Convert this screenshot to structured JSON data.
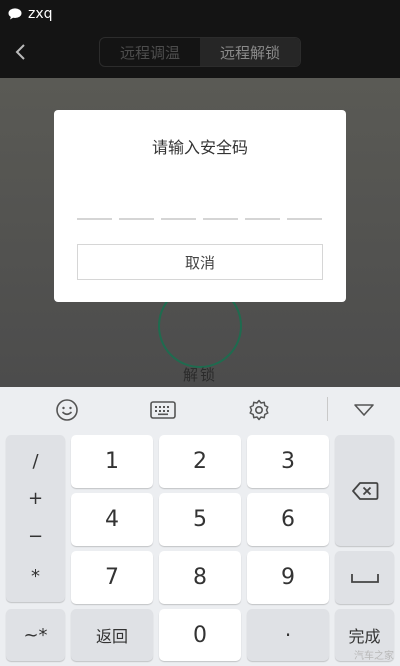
{
  "status_bar": {
    "app_label": "zxq"
  },
  "nav": {
    "tabs": [
      {
        "label": "远程调温",
        "active": false
      },
      {
        "label": "远程解锁",
        "active": true
      }
    ]
  },
  "content": {
    "unlock_label": "解锁"
  },
  "dialog": {
    "title": "请输入安全码",
    "code_length": 6,
    "cancel_label": "取消"
  },
  "keyboard": {
    "toolbar_icons": [
      "emoji-icon",
      "keyboard-icon",
      "settings-icon",
      "collapse-icon"
    ],
    "symbols": [
      "/",
      "+",
      "−",
      "*"
    ],
    "digits": [
      "1",
      "2",
      "3",
      "4",
      "5",
      "6",
      "7",
      "8",
      "9",
      "0"
    ],
    "switch_label": "~*",
    "back_label": "返回",
    "dot_label": "·",
    "done_label": "完成",
    "delete_icon": "backspace-icon",
    "space_icon": "space-icon"
  },
  "watermark": "汽车之家",
  "colors": {
    "accent": "#1f6b4f",
    "dialog_bg": "#ffffff",
    "keyboard_bg": "#eceef1"
  }
}
